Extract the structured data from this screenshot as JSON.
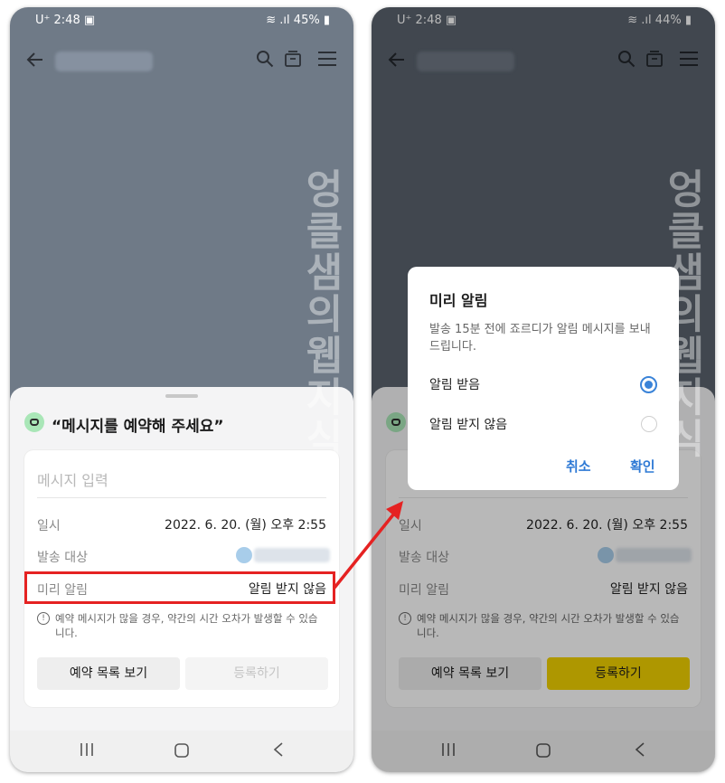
{
  "left": {
    "status_time": "2:48",
    "carrier": "U⁺",
    "battery": "45%",
    "sheet_title": "“메시지를 예약해 주세요”",
    "msg_placeholder": "메시지 입력",
    "date_label": "일시",
    "date_value": "2022. 6. 20. (월) 오후 2:55",
    "recipient_label": "발송 대상",
    "reminder_label": "미리 알림",
    "reminder_value": "알림 받지 않음",
    "notice": "예약 메시지가 많을 경우, 약간의 시간 오차가 발생할 수 있습니다.",
    "btn_list": "예약 목록 보기",
    "btn_register": "등록하기"
  },
  "right": {
    "status_time": "2:48",
    "carrier": "U⁺",
    "battery": "44%",
    "date_label": "일시",
    "date_value": "2022. 6. 20. (월) 오후 2:55",
    "recipient_label": "발송 대상",
    "reminder_label": "미리 알림",
    "reminder_value": "알림 받지 않음",
    "notice": "예약 메시지가 많을 경우, 약간의 시간 오차가 발생할 수 있습니다.",
    "btn_list": "예약 목록 보기",
    "btn_register": "등록하기",
    "dialog": {
      "title": "미리 알림",
      "desc": "발송 15분 전에 죠르디가 알림 메시지를 보내드립니다.",
      "option_on": "알림 받음",
      "option_off": "알림 받지 않음",
      "selected": "알림 받음",
      "cancel": "취소",
      "ok": "확인"
    }
  },
  "watermark": "엉클샘의웹지식",
  "colors": {
    "highlight": "#e52222",
    "accent": "#3a83d8",
    "register_active": "#f2d200"
  }
}
